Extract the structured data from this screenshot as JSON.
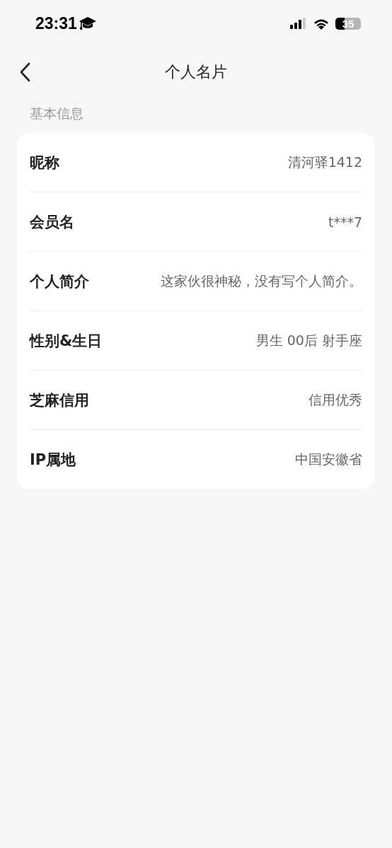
{
  "status_bar": {
    "time": "23:31",
    "battery": "35"
  },
  "nav": {
    "title": "个人名片"
  },
  "section": {
    "title": "基本信息"
  },
  "rows": [
    {
      "label": "昵称",
      "value": "清河驿1412"
    },
    {
      "label": "会员名",
      "value": "t***7"
    },
    {
      "label": "个人简介",
      "value": "这家伙很神秘，没有写个人简介。"
    },
    {
      "label": "性别&生日",
      "value": "男生 00后 射手座"
    },
    {
      "label": "芝麻信用",
      "value": "信用优秀"
    },
    {
      "label": "IP属地",
      "value": "中国安徽省"
    }
  ]
}
